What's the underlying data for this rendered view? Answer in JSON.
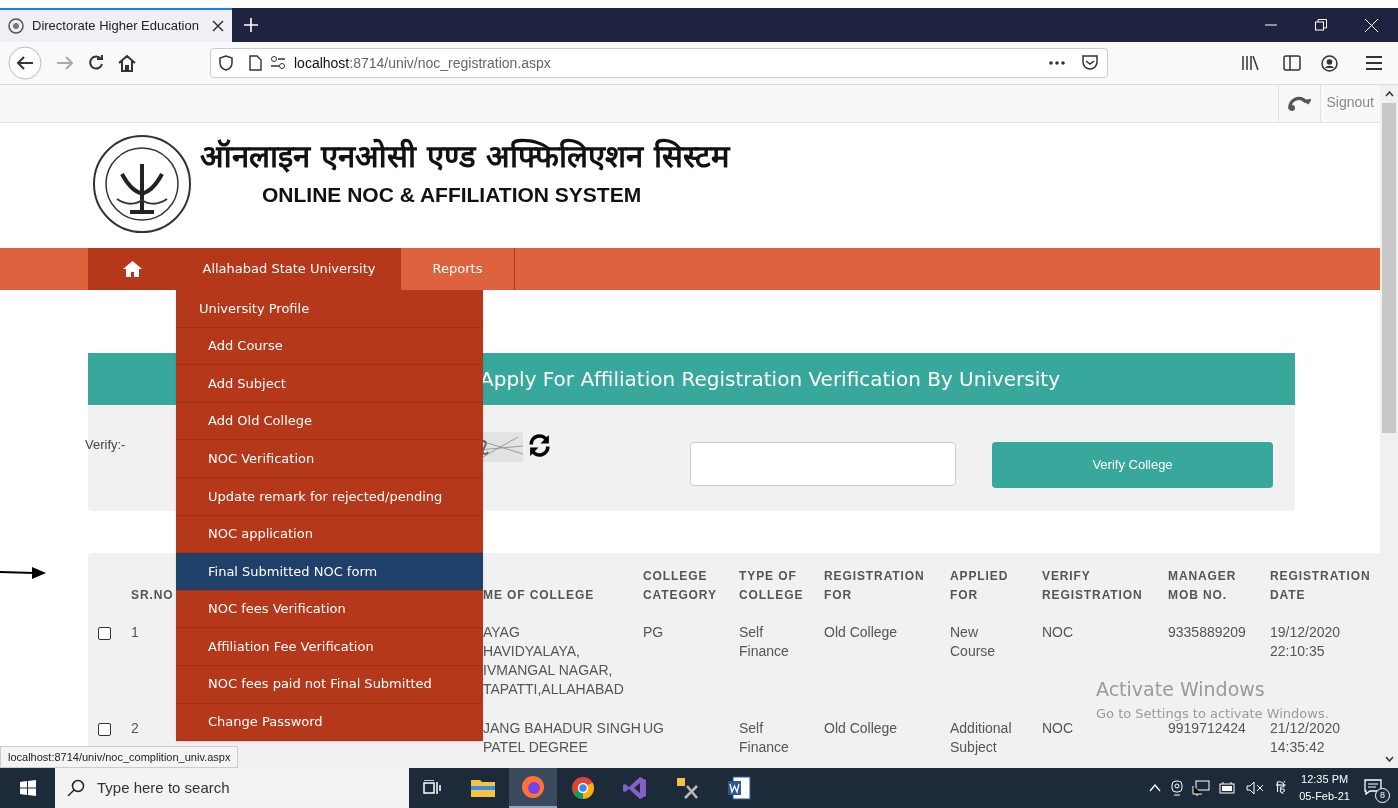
{
  "browser": {
    "tab_title": "Directorate Higher Education",
    "url_host": "localhost",
    "url_rest": ":8714/univ/noc_registration.aspx"
  },
  "topbar": {
    "signout": "Signout"
  },
  "header": {
    "title_hindi": "ऑनलाइन एनओसी एण्ड अफ्फिलिएशन सिस्टम",
    "title_english": "ONLINE NOC & AFFILIATION SYSTEM"
  },
  "nav": [
    {
      "label": "Allahabad State University",
      "selected": true
    },
    {
      "label": "Reports",
      "selected": false
    }
  ],
  "dropdown": [
    {
      "kind": "top",
      "label": "University Profile",
      "selected": false
    },
    {
      "kind": "sub",
      "label": "Add Course",
      "selected": false
    },
    {
      "kind": "sub",
      "label": "Add Subject",
      "selected": false
    },
    {
      "kind": "sub",
      "label": "Add Old College",
      "selected": false
    },
    {
      "kind": "sub",
      "label": "NOC Verification",
      "selected": false
    },
    {
      "kind": "sub",
      "label": "Update remark for rejected/pending",
      "selected": false
    },
    {
      "kind": "sub",
      "label": "NOC application",
      "selected": false
    },
    {
      "kind": "sub",
      "label": "Final Submitted NOC form",
      "selected": true
    },
    {
      "kind": "sub",
      "label": "NOC fees Verification",
      "selected": false
    },
    {
      "kind": "sub",
      "label": "Affiliation Fee Verification",
      "selected": false
    },
    {
      "kind": "sub",
      "label": "NOC fees paid not Final Submitted",
      "selected": false
    },
    {
      "kind": "sub",
      "label": "Change Password",
      "selected": false
    }
  ],
  "panel": {
    "title": "Apply For Affiliation Registration Verification By University",
    "verify_label": "Verify:-",
    "button": "Verify College"
  },
  "table": {
    "columns": [
      "SR.NO",
      "ME OF COLLEGE",
      "COLLEGE CATEGORY",
      "TYPE OF COLLEGE",
      "REGISTRATION FOR",
      "APPLIED FOR",
      "VERIFY REGISTRATION",
      "MANAGER MOB NO.",
      "REGISTRATION DATE"
    ],
    "rows": [
      {
        "checked": false,
        "cells": [
          "1",
          "AYAG\nHAVIDYALAYA,\nIVMANGAL NAGAR,\nTAPATTI,ALLAHABAD",
          "PG",
          "Self Finance",
          "Old College",
          "New Course",
          "NOC",
          "9335889209",
          "19/12/2020 22:10:35"
        ]
      },
      {
        "checked": false,
        "cells": [
          "2",
          "JANG BAHADUR SINGH PATEL DEGREE",
          "UG",
          "Self Finance",
          "Old College",
          "Additional Subject",
          "NOC",
          "9919712424",
          "21/12/2020 14:35:42"
        ]
      }
    ]
  },
  "status_link": "localhost:8714/univ/noc_complition_univ.aspx",
  "activation": {
    "title": "Activate Windows",
    "text": "Go to Settings to activate Windows."
  },
  "taskbar": {
    "search_placeholder": "Type here to search",
    "language": "हिं",
    "time": "12:35 PM",
    "date": "05-Feb-21",
    "notifications": "8"
  }
}
